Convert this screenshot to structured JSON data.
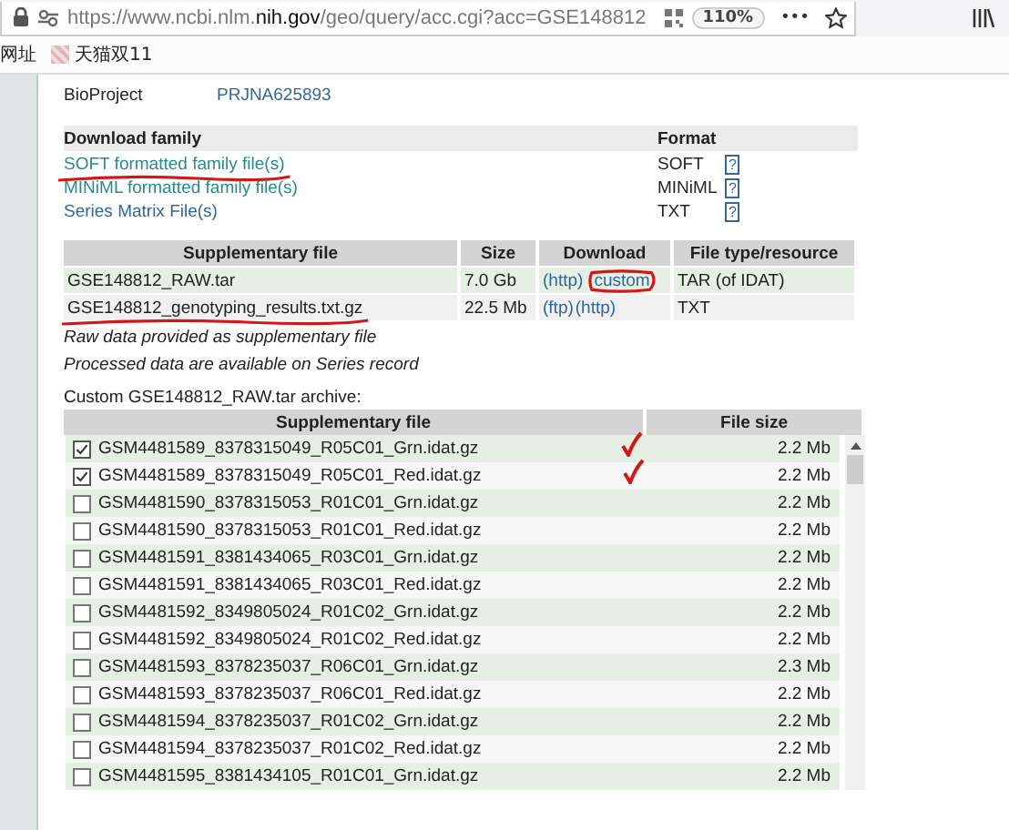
{
  "browser": {
    "url_prefix": "https://www.ncbi.nlm.",
    "url_domain": "nih.gov",
    "url_path": "/geo/query/acc.cgi?acc=GSE148812",
    "zoom": "110%",
    "menu": "•••"
  },
  "bookmarks": [
    {
      "label": "网址",
      "icon": false
    },
    {
      "label": "天猫双11",
      "icon": true
    }
  ],
  "relations": [
    {
      "label": "BioProject",
      "value": "PRJNA625893"
    }
  ],
  "download_family": {
    "columns": [
      "Download family",
      "Format"
    ],
    "rows": [
      {
        "file": "SOFT formatted family file(s)",
        "format": "SOFT",
        "help": "?",
        "underlined": true
      },
      {
        "file": "MINiML formatted family file(s)",
        "format": "MINiML",
        "help": "?",
        "underlined": false
      },
      {
        "file": "Series Matrix File(s)",
        "format": "TXT",
        "help": "?",
        "underlined": false
      }
    ]
  },
  "supplementary": {
    "columns": [
      "Supplementary file",
      "Size",
      "Download",
      "File type/resource"
    ],
    "rows": [
      {
        "file": "GSE148812_RAW.tar",
        "size": "7.0 Gb",
        "links": [
          {
            "label": "(http)",
            "circled": false
          },
          {
            "label": "custom",
            "circled": true
          }
        ],
        "type": "TAR (of IDAT)",
        "underlined": false
      },
      {
        "file": "GSE148812_genotyping_results.txt.gz",
        "size": "22.5 Mb",
        "links": [
          {
            "label": "(ftp)",
            "circled": false
          },
          {
            "label": "(http)",
            "circled": false
          }
        ],
        "type": "TXT",
        "underlined": true
      }
    ],
    "notes": [
      "Raw data provided as supplementary file",
      "Processed data are available on Series record"
    ]
  },
  "custom_archive": {
    "title": "Custom GSE148812_RAW.tar archive:",
    "columns": [
      "Supplementary file",
      "File size"
    ],
    "rows": [
      {
        "file": "GSM4481589_8378315049_R05C01_Grn.idat.gz",
        "size": "2.2 Mb",
        "checked": true,
        "ticked": true
      },
      {
        "file": "GSM4481589_8378315049_R05C01_Red.idat.gz",
        "size": "2.2 Mb",
        "checked": true,
        "ticked": true
      },
      {
        "file": "GSM4481590_8378315053_R01C01_Grn.idat.gz",
        "size": "2.2 Mb",
        "checked": false,
        "ticked": false
      },
      {
        "file": "GSM4481590_8378315053_R01C01_Red.idat.gz",
        "size": "2.2 Mb",
        "checked": false,
        "ticked": false
      },
      {
        "file": "GSM4481591_8381434065_R03C01_Grn.idat.gz",
        "size": "2.2 Mb",
        "checked": false,
        "ticked": false
      },
      {
        "file": "GSM4481591_8381434065_R03C01_Red.idat.gz",
        "size": "2.2 Mb",
        "checked": false,
        "ticked": false
      },
      {
        "file": "GSM4481592_8349805024_R01C02_Grn.idat.gz",
        "size": "2.2 Mb",
        "checked": false,
        "ticked": false
      },
      {
        "file": "GSM4481592_8349805024_R01C02_Red.idat.gz",
        "size": "2.2 Mb",
        "checked": false,
        "ticked": false
      },
      {
        "file": "GSM4481593_8378235037_R06C01_Grn.idat.gz",
        "size": "2.3 Mb",
        "checked": false,
        "ticked": false
      },
      {
        "file": "GSM4481593_8378235037_R06C01_Red.idat.gz",
        "size": "2.2 Mb",
        "checked": false,
        "ticked": false
      },
      {
        "file": "GSM4481594_8378235037_R01C02_Grn.idat.gz",
        "size": "2.2 Mb",
        "checked": false,
        "ticked": false
      },
      {
        "file": "GSM4481594_8378235037_R01C02_Red.idat.gz",
        "size": "2.2 Mb",
        "checked": false,
        "ticked": false
      },
      {
        "file": "GSM4481595_8381434105_R01C01_Grn.idat.gz",
        "size": "2.2 Mb",
        "checked": false,
        "ticked": false
      }
    ]
  }
}
